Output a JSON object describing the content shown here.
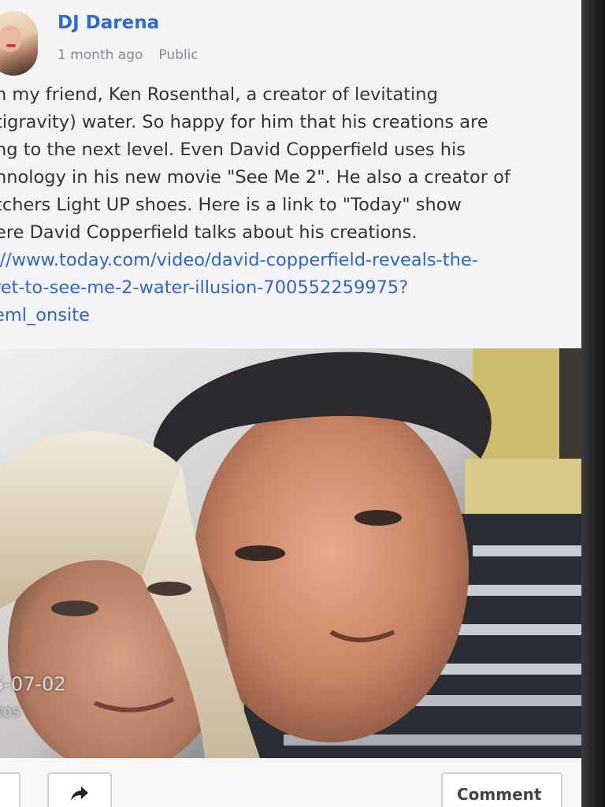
{
  "post": {
    "author": "DJ Darena",
    "time": "1 month ago",
    "visibility": "Public",
    "text_lines": [
      "h my friend, Ken Rosenthal, a creator of levitating",
      "tigravity) water. So happy for him that his creations are",
      "ng to the next level. Even David Copperfield uses his",
      "nnology in his new movie \"See Me 2\". He also a creator of",
      "tchers Light UP shoes. Here is a link to \"Today\" show",
      "ere David Copperfield talks about his creations."
    ],
    "link_lines": [
      "://www.today.com/video/david-copperfield-reveals-the-",
      "ret-to-see-me-2-water-illusion-700552259975?",
      "eml_onsite"
    ]
  },
  "photo": {
    "date_overlay": "5-07-02",
    "sub_overlay": "tos"
  },
  "actions": {
    "share_icon": "share-arrow-icon",
    "comment_label": "Comment"
  },
  "colors": {
    "author_blue": "#2d6bd0",
    "link_blue": "#2f66c8",
    "meta_gray": "#8a8a8e"
  }
}
